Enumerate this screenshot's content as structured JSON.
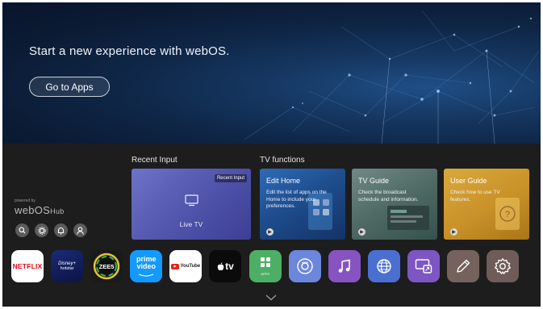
{
  "hero": {
    "title": "Start a new experience with webOS.",
    "button_label": "Go to Apps"
  },
  "sections": {
    "recent_input_label": "Recent Input",
    "tv_functions_label": "TV functions"
  },
  "recent_card": {
    "badge": "Recent Input",
    "label": "Live TV"
  },
  "function_cards": [
    {
      "title": "Edit Home",
      "description": [
        "Edit the list of apps on the",
        "Home to include your",
        "preferences."
      ]
    },
    {
      "title": "TV Guide",
      "description": [
        "Check the broadcast",
        "schedule and information."
      ]
    },
    {
      "title": "User Guide",
      "description": [
        "Check how to use TV",
        "features."
      ]
    }
  ],
  "brand": {
    "powered_by": "powered by",
    "name": "webOS",
    "suffix": "Hub"
  },
  "quick_icons": [
    "search-icon",
    "settings-icon",
    "notification-bell-icon",
    "account-icon"
  ],
  "apps": [
    {
      "name": "NETFLIX",
      "icon": "netflix-icon",
      "bg": "#ffffff",
      "fg": "#e50914"
    },
    {
      "name": "Disney+ hotstar",
      "icon": "disney-hotstar-icon",
      "bg": "#0f1a4d",
      "fg": "#ffffff"
    },
    {
      "name": "ZEE5",
      "icon": "zee5-icon",
      "bg": "#1a1a1a",
      "fg": "#ffffff"
    },
    {
      "name": "prime video",
      "icon": "prime-video-icon",
      "bg": "#1399ff",
      "fg": "#ffffff"
    },
    {
      "name": "YouTube",
      "icon": "youtube-icon",
      "bg": "#ffffff",
      "fg": "#212121"
    },
    {
      "name": "tv",
      "icon": "apple-tv-icon",
      "bg": "#0b0b0b",
      "fg": "#ffffff"
    },
    {
      "name": "APPS",
      "icon": "apps-grid-icon",
      "bg": "#4caf65",
      "fg": "#ffffff"
    },
    {
      "name": "",
      "icon": "camera-icon",
      "bg": "#6b86db",
      "fg": "#ffffff"
    },
    {
      "name": "",
      "icon": "music-icon",
      "bg": "#8753c2",
      "fg": "#ffffff"
    },
    {
      "name": "",
      "icon": "web-browser-icon",
      "bg": "#4a6fd0",
      "fg": "#ffffff"
    },
    {
      "name": "",
      "icon": "screen-share-icon",
      "bg": "#7d56c4",
      "fg": "#ffffff"
    },
    {
      "name": "",
      "icon": "edit-pencil-icon",
      "bg": "#75625d",
      "fg": "#ffffff"
    },
    {
      "name": "",
      "icon": "settings-gear-icon",
      "bg": "#6f5c58",
      "fg": "#ffffff"
    }
  ],
  "colors": {
    "background": "#1d1d1d",
    "hero_dark": "#09152a",
    "hero_glow": "#1f4f86"
  }
}
